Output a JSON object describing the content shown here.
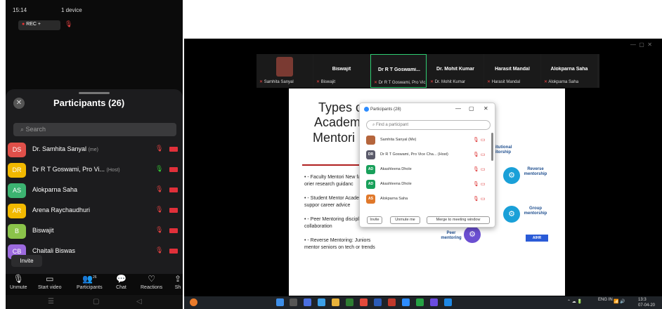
{
  "phone": {
    "status_time": "15:14",
    "status_center": "1 device",
    "rec_label": "REC",
    "panel_title": "Participants (26)",
    "search_placeholder": "Search",
    "participants": [
      {
        "initials": "DS",
        "name": "Dr. Samhita Sanyal",
        "tag": "(me)",
        "color": "#e0504a",
        "mic": "muted"
      },
      {
        "initials": "DR",
        "name": "Dr R T Goswami, Pro Vi...",
        "tag": "(Host)",
        "color": "#f2b900",
        "mic": "on"
      },
      {
        "initials": "AS",
        "name": "Alokparna Saha",
        "tag": "",
        "color": "#3cb371",
        "mic": "muted"
      },
      {
        "initials": "AR",
        "name": "Arena Raychaudhuri",
        "tag": "",
        "color": "#f2b900",
        "mic": "muted"
      },
      {
        "initials": "B",
        "name": "Biswajit",
        "tag": "",
        "color": "#8bc34a",
        "mic": "muted"
      },
      {
        "initials": "CB",
        "name": "Chaitali Biswas",
        "tag": "",
        "color": "#9c6ade",
        "mic": "muted"
      }
    ],
    "invite_label": "Invite",
    "toolbar": [
      {
        "icon": "microphone-icon",
        "label": "Unmute"
      },
      {
        "icon": "video-camera-icon",
        "label": "Start video"
      },
      {
        "icon": "participants-icon",
        "label": "Participants",
        "badge": "26"
      },
      {
        "icon": "chat-icon",
        "label": "Chat"
      },
      {
        "icon": "heart-icon",
        "label": "Reactions"
      },
      {
        "icon": "share-icon",
        "label": "Sh"
      }
    ]
  },
  "desktop": {
    "video_tiles": [
      {
        "name": "",
        "sub": "Samhita Sanyal"
      },
      {
        "name": "Biswajit",
        "sub": "Biswajit"
      },
      {
        "name": "Dr R T Goswami...",
        "sub": "Dr R T Goswami, Pro Vic...",
        "active": true
      },
      {
        "name": "Dr. Mohit Kumar",
        "sub": "Dr. Mohit Kumar"
      },
      {
        "name": "Harasit Mandal",
        "sub": "Harasit Mandal"
      },
      {
        "name": "Alokparna Saha",
        "sub": "Alokparna Saha"
      }
    ],
    "slide": {
      "title_lines": [
        "Types c",
        "Academ",
        "Mentori"
      ],
      "bullets": [
        "- Faculty Mentori New faculty orier research guidanc",
        "- Student Mentor Academic suppor career advice",
        "- Peer Mentoring disciplinary collaboration",
        "- Reverse Mentoring: Juniors mentor seniors on tech or trends"
      ],
      "circle_labels": [
        "itutional itorship",
        "Reverse mentorship",
        "Group mentorship",
        "Peer mentoring"
      ],
      "brand": "AIHR"
    },
    "popup": {
      "title": "Participants (28)",
      "find_placeholder": "Find a participant",
      "rows": [
        {
          "initials": "",
          "name": "Samhita Sanyal (Me)",
          "color": "#b5653c"
        },
        {
          "initials": "DR",
          "name": "Dr R T Goswami, Pro Vice Cha... (Host)",
          "color": "#5a5a6a"
        },
        {
          "initials": "AD",
          "name": "Akashleena Dhole",
          "color": "#18a05a"
        },
        {
          "initials": "AD",
          "name": "Akashleena Dhole",
          "color": "#18a05a"
        },
        {
          "initials": "AS",
          "name": "Alokparna Saha",
          "color": "#e0782a"
        }
      ],
      "buttons": [
        "Invite",
        "Unmute me",
        "Merge to meeting window"
      ]
    },
    "taskbar": {
      "lang": "ENG IN",
      "time": "13:3",
      "date": "07-04-20"
    }
  }
}
